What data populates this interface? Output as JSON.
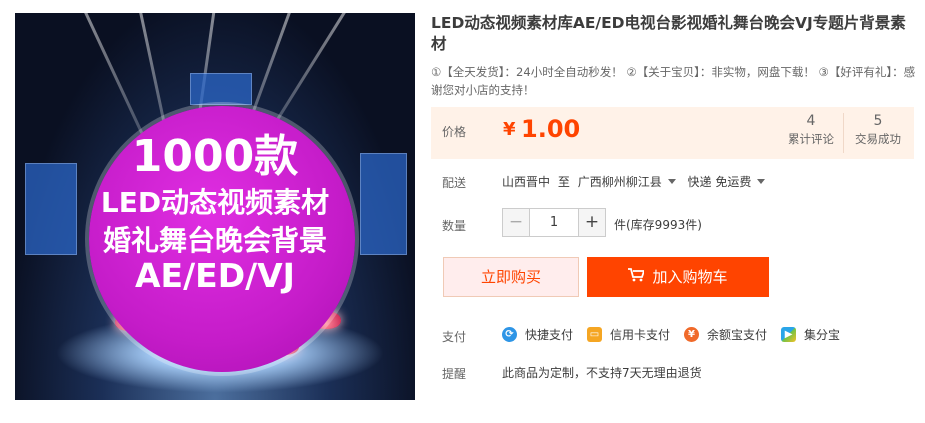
{
  "product_image": {
    "line1": "1000款",
    "line2": "LED动态视频素材",
    "line3": "婚礼舞台晚会背景",
    "line4": "AE/ED/VJ"
  },
  "product": {
    "title": "LED动态视频素材库AE/ED电视台影视婚礼舞台晚会VJ专题片背景素材",
    "description": "①【全天发货】：24小时全自动秒发！ ②【关于宝贝】：非实物，网盘下载！ ③【好评有礼】：感谢您对小店的支持！"
  },
  "price": {
    "label": "价格",
    "currency": "¥",
    "amount": "1.00",
    "reviews_count": "4",
    "reviews_label": "累计评论",
    "sales_count": "5",
    "sales_label": "交易成功"
  },
  "shipping": {
    "label": "配送",
    "from": "山西晋中",
    "to_word": "至",
    "destination": "广西柳州柳江县",
    "method": "快递 免运费"
  },
  "quantity": {
    "label": "数量",
    "minus": "−",
    "value": "1",
    "plus": "+",
    "stock": "件(库存9993件)"
  },
  "actions": {
    "buy_now": "立即购买",
    "add_to_cart": "加入购物车"
  },
  "payment": {
    "label": "支付",
    "methods": [
      "快捷支付",
      "信用卡支付",
      "余额宝支付",
      "集分宝"
    ]
  },
  "notice": {
    "label": "提醒",
    "text": "此商品为定制，不支持7天无理由退货"
  },
  "colors": {
    "accent": "#ff4400",
    "price_bg": "#fff2e8",
    "buy_bg": "#ffeded"
  }
}
